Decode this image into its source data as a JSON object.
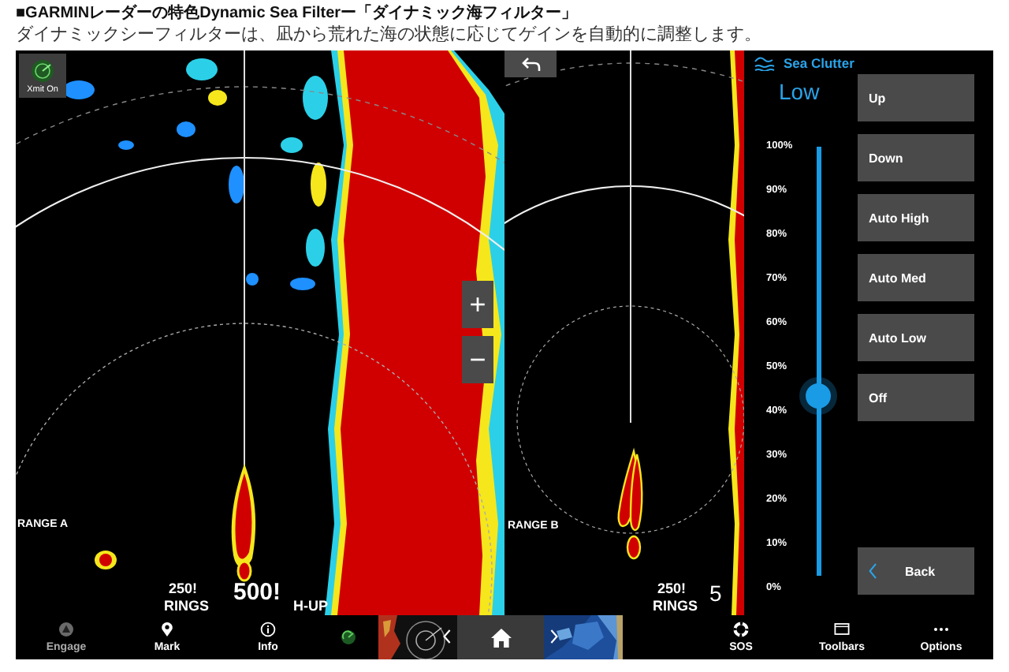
{
  "header": {
    "title": "■GARMINレーダーの特色Dynamic Sea Filterー「ダイナミック海フィルター」",
    "subtitle": "ダイナミックシーフィルターは、凪から荒れた海の状態に応じてゲインを自動的に調整します。"
  },
  "radar_a": {
    "transmit": "Xmit On",
    "zoom_in": "+",
    "zoom_out": "−",
    "range_label": "RANGE A",
    "ring_spacing": "250!",
    "rings_label": "RINGS",
    "range": "500!",
    "orientation": "H-UP"
  },
  "radar_b": {
    "range_label": "RANGE B",
    "ring_spacing": "250!",
    "rings_label": "RINGS",
    "range": "5"
  },
  "sea_clutter": {
    "title": "Sea Clutter",
    "mode": "Low",
    "scale": [
      "100%",
      "90%",
      "80%",
      "70%",
      "60%",
      "50%",
      "40%",
      "30%",
      "20%",
      "10%",
      "0%"
    ],
    "level": 0.42,
    "buttons": [
      "Up",
      "Down",
      "Auto High",
      "Auto Med",
      "Auto Low",
      "Off"
    ],
    "back": "Back"
  },
  "bottom_bar": {
    "left": [
      {
        "label": "Engage",
        "disabled": true
      },
      {
        "label": "Mark",
        "disabled": false
      },
      {
        "label": "Info",
        "disabled": false
      }
    ],
    "right": [
      {
        "label": "SOS",
        "disabled": false
      },
      {
        "label": "Toolbars",
        "disabled": false
      },
      {
        "label": "Options",
        "disabled": false
      }
    ]
  }
}
